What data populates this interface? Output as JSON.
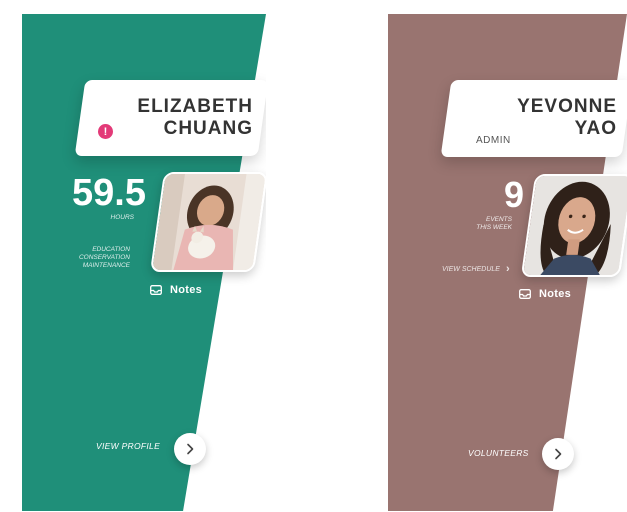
{
  "colors": {
    "card_left_bg": "#1f8f79",
    "card_right_bg": "#997470",
    "alert": "#e33a78"
  },
  "left_card": {
    "name_line1": "ELIZABETH",
    "name_line2": "CHUANG",
    "alert_symbol": "!",
    "hours_value": "59.5",
    "hours_label": "HOURS",
    "tags": [
      "EDUCATION",
      "CONSERVATION",
      "MAINTENANCE"
    ],
    "notes_label": "Notes",
    "footer_label": "VIEW PROFILE",
    "photo_icon": "woman-with-dog-photo",
    "button_icon": "chevron-right-icon"
  },
  "right_card": {
    "name_line1": "YEVONNE",
    "name_line2": "YAO",
    "role": "ADMIN",
    "events_value": "9",
    "events_label_line1": "EVENTS",
    "events_label_line2": "THIS WEEK",
    "schedule_link": "VIEW SCHEDULE",
    "schedule_chevron": "›",
    "notes_label": "Notes",
    "footer_label": "VOLUNTEERS",
    "photo_icon": "woman-portrait-photo",
    "button_icon": "chevron-right-icon"
  }
}
